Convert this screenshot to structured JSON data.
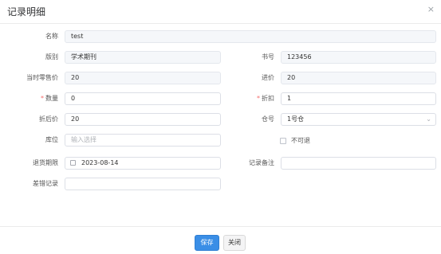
{
  "dialog": {
    "title": "记录明细",
    "close_glyph": "×"
  },
  "form": {
    "name_label": "名称",
    "name_value": "test",
    "edition_label": "版别",
    "edition_value": "学术期刊",
    "book_no_label": "书号",
    "book_no_value": "123456",
    "retail_price_label": "当时零售价",
    "retail_price_value": "20",
    "purchase_price_label": "进价",
    "purchase_price_value": "20",
    "quantity_label": "数量",
    "quantity_value": "0",
    "discount_label": "折扣",
    "discount_value": "1",
    "discounted_price_label": "折后价",
    "discounted_price_value": "20",
    "warehouse_label": "仓号",
    "warehouse_value": "1号仓",
    "location_label": "库位",
    "location_placeholder": "输入选择",
    "non_returnable_label": "不可退",
    "return_deadline_label": "退货期限",
    "return_deadline_value": "2023-08-14",
    "record_note_label": "记录备注",
    "record_note_value": "",
    "error_record_label": "差错记录",
    "error_record_value": "",
    "required_mark": "*",
    "chevron_glyph": "⌄"
  },
  "footer": {
    "save_label": "保存",
    "close_label": "关闭"
  }
}
